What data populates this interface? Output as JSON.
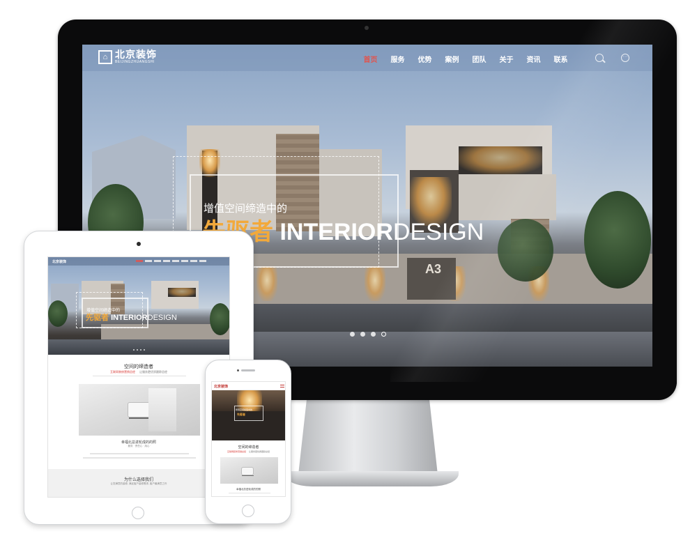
{
  "site": {
    "logo_cn": "北京装饰",
    "logo_en": "BEIJINGZHUANGSHI",
    "logo_mark": "⌂",
    "nav": [
      "首页",
      "服务",
      "优势",
      "案例",
      "团队",
      "关于",
      "资讯",
      "联系"
    ],
    "nav_active_index": 0,
    "more_glyph": "···"
  },
  "hero": {
    "line1": "增值空间缔造中的",
    "line2_cn": "先驱者",
    "line2_en_bold": "INTERIOR",
    "line2_en_light": "DESIGN",
    "sign": "A3",
    "slides": 4,
    "active_slide": 3
  },
  "tablet": {
    "section_title": "空间的缔造者",
    "tag_red": "互联网装修营销总经",
    "tag_grey": "让服务更优质跟踪总经",
    "caption": "幸福北总进轮成的的照",
    "caption_sub": "· 服务 · 责任心 · 用心 ·",
    "why_title": "为什么选择我们",
    "why_sub": "让您满意的装修, 满足客户装修需求, 客户最满意之作"
  },
  "phone": {
    "logo": "北京装饰",
    "section_title": "空间的缔造者",
    "tag_red": "互联网装修营销总经",
    "tag_grey": "让服务更优质跟踪总经",
    "caption": "幸福北总进轮成的的照"
  },
  "colors": {
    "accent_red": "#e0554f",
    "hero_orange": "#f2a93b",
    "device_black": "#0b0b0c"
  }
}
